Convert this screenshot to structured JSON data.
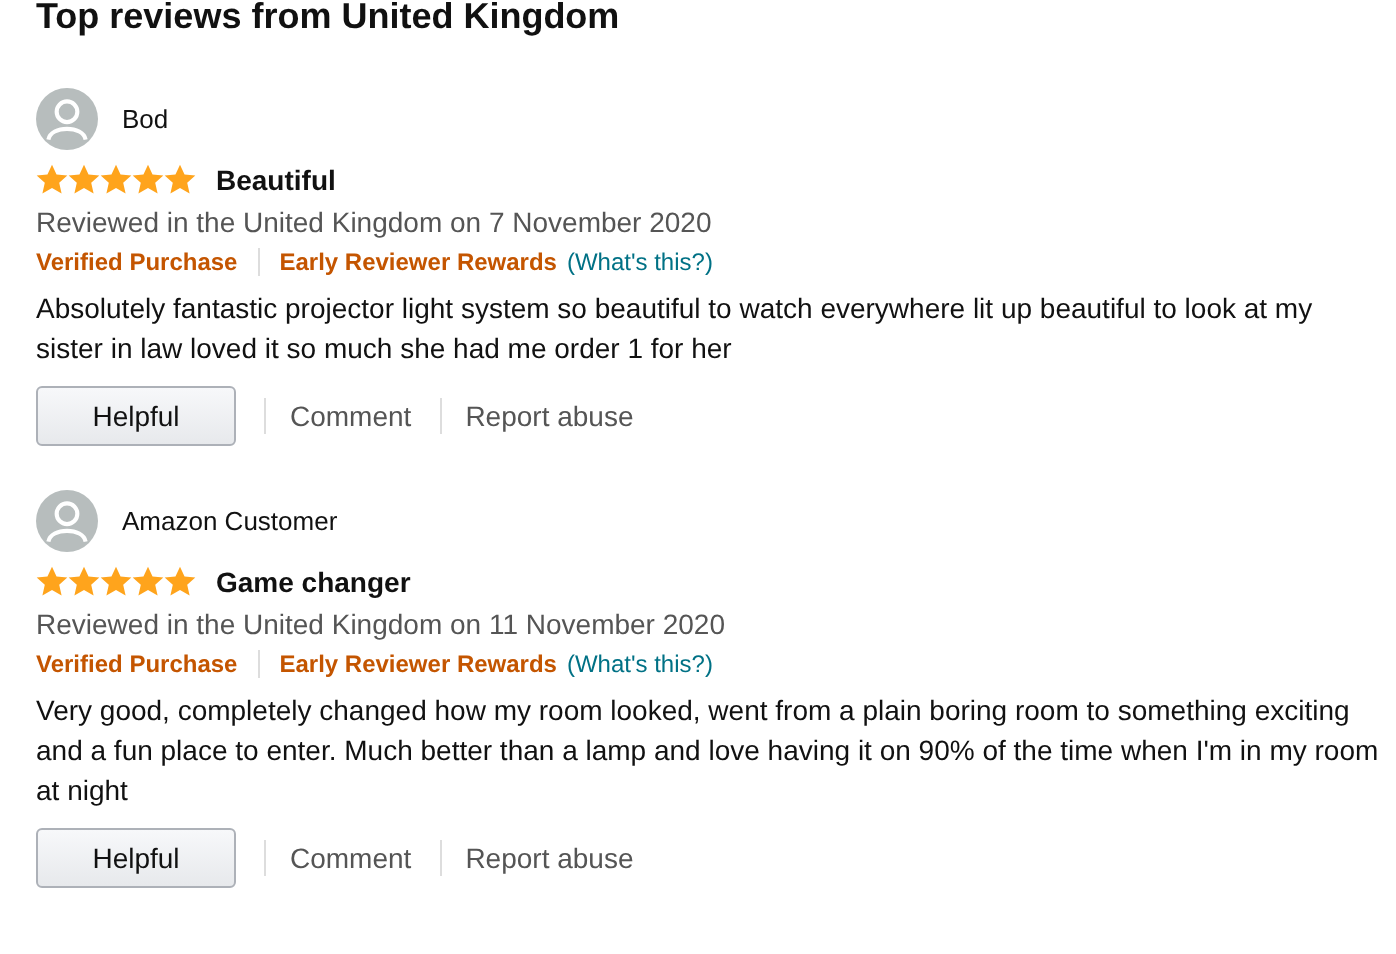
{
  "heading": "Top reviews from United Kingdom",
  "reviews": [
    {
      "author": "Bod",
      "stars": 5,
      "title": "Beautiful",
      "date": "Reviewed in the United Kingdom on 7 November 2020",
      "verified": "Verified Purchase",
      "rewards": "Early Reviewer Rewards",
      "rewards_link": "(What's this?)",
      "body": "Absolutely fantastic projector light system so beautiful to watch everywhere lit up beautiful to look at my sister in law loved it so much she had me order 1 for her",
      "actions": [
        "Helpful",
        "Comment",
        "Report abuse"
      ]
    },
    {
      "author": "Amazon Customer",
      "stars": 5,
      "title": "Game changer",
      "date": "Reviewed in the United Kingdom on 11 November 2020",
      "verified": "Verified Purchase",
      "rewards": "Early Reviewer Rewards",
      "rewards_link": "(What's this?)",
      "body": "Very good, completely changed how my room looked, went from a plain boring room to something exciting and a fun place to enter. Much better than a lamp and love having it on 90% of the time when I'm in my room at night",
      "actions": [
        "Helpful",
        "Comment",
        "Report abuse"
      ]
    }
  ]
}
